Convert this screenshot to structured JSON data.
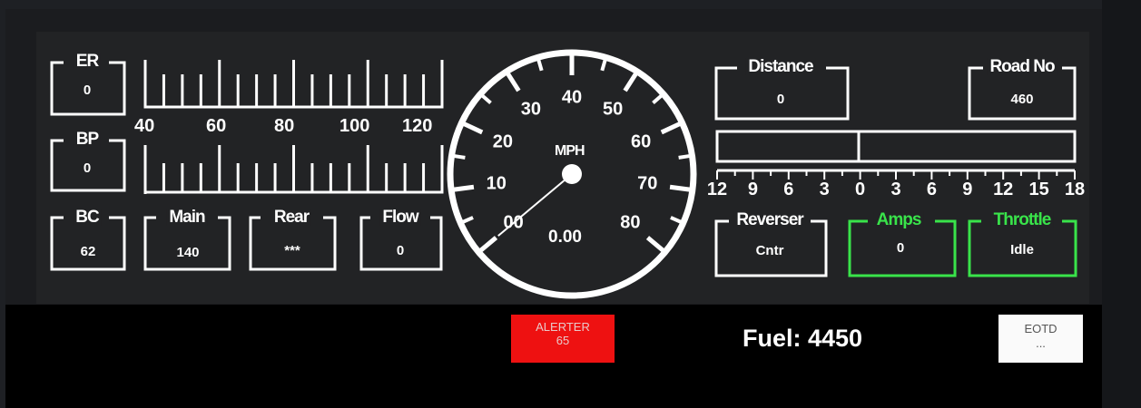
{
  "gauges": {
    "er": {
      "label": "ER",
      "value": "0"
    },
    "bp": {
      "label": "BP",
      "value": "0"
    },
    "bc": {
      "label": "BC",
      "value": "62"
    },
    "main": {
      "label": "Main",
      "value": "140"
    },
    "rear": {
      "label": "Rear",
      "value": "***"
    },
    "flow": {
      "label": "Flow",
      "value": "0"
    },
    "distance": {
      "label": "Distance",
      "value": "0"
    },
    "road_no": {
      "label": "Road No",
      "value": "460"
    },
    "reverser": {
      "label": "Reverser",
      "value": "Cntr"
    },
    "amps": {
      "label": "Amps",
      "value": "0"
    },
    "throttle": {
      "label": "Throttle",
      "value": "Idle"
    }
  },
  "pressure_scale": {
    "ticks": [
      "40",
      "60",
      "80",
      "100",
      "120"
    ]
  },
  "speedometer": {
    "unit": "MPH",
    "digital": "0.00",
    "speed": 0,
    "ticks": [
      "00",
      "10",
      "20",
      "30",
      "40",
      "50",
      "60",
      "70",
      "80"
    ]
  },
  "amp_scale": {
    "ticks": [
      "12",
      "9",
      "6",
      "3",
      "0",
      "3",
      "6",
      "9",
      "12",
      "15",
      "18"
    ]
  },
  "alerter": {
    "label": "ALERTER",
    "value": "65",
    "color": "#ee1111"
  },
  "fuel": {
    "text": "Fuel: 4450"
  },
  "eotd": {
    "label": "EOTD",
    "value": "..."
  },
  "colors": {
    "panel": "#222325",
    "accent_green": "#39e34a",
    "alert_red": "#ee1111"
  }
}
